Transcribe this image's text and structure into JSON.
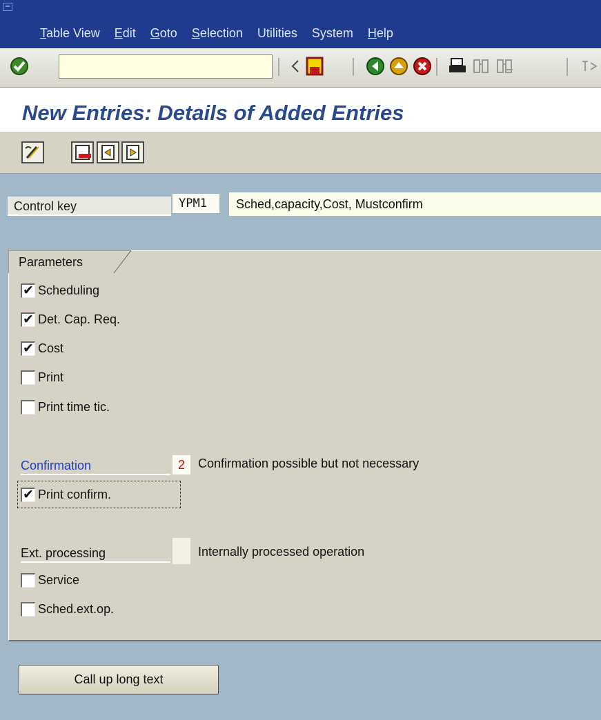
{
  "menu": [
    {
      "mnemonic": "T",
      "rest": "able View"
    },
    {
      "mnemonic": "E",
      "rest": "dit"
    },
    {
      "mnemonic": "G",
      "rest": "oto"
    },
    {
      "mnemonic": "S",
      "rest": "election"
    },
    {
      "mnemonic": "",
      "rest": "Utilities"
    },
    {
      "mnemonic": "",
      "rest": "System"
    },
    {
      "mnemonic": "H",
      "rest": "elp"
    }
  ],
  "toolbar": {
    "command_value": "",
    "icons": [
      "enter-check-icon",
      "command-field",
      "history-list-icon",
      "collapse-arrow-icon",
      "save-icon",
      "back-icon",
      "exit-icon",
      "cancel-icon",
      "print-icon",
      "find-icon",
      "find-next-icon",
      "first-page-icon"
    ]
  },
  "page": {
    "title": "New Entries: Details of Added Entries"
  },
  "app_toolbar": {
    "icons": [
      "display-change-icon",
      "delete-icon",
      "previous-entry-icon",
      "next-entry-icon"
    ]
  },
  "form": {
    "control_key_label": "Control key",
    "control_key_value": "YPM1",
    "control_key_desc": "Sched,capacity,Cost, Mustconfirm",
    "group_title": "Parameters",
    "checkboxes": [
      {
        "label": "Scheduling",
        "checked": true
      },
      {
        "label": "Det. Cap. Req.",
        "checked": true
      },
      {
        "label": "Cost",
        "checked": true
      },
      {
        "label": "Print",
        "checked": false
      },
      {
        "label": "Print time tic.",
        "checked": false
      }
    ],
    "confirmation_label": "Confirmation",
    "confirmation_value": "2",
    "confirmation_desc": "Confirmation possible but not necessary",
    "print_confirm": {
      "label": "Print confirm.",
      "checked": true
    },
    "ext_label": "Ext. processing",
    "ext_value": "",
    "ext_desc": "Internally processed operation",
    "ext_checkboxes": [
      {
        "label": "Service",
        "checked": false
      },
      {
        "label": "Sched.ext.op.",
        "checked": false
      }
    ]
  },
  "buttons": {
    "long_text": "Call up long text"
  },
  "colors": {
    "menubar": "#1f3b8e",
    "background": "#a2b8c9",
    "title": "#2b4a8d",
    "confirmation_label": "#1b3ec4",
    "confirmation_value": "#e00000"
  }
}
